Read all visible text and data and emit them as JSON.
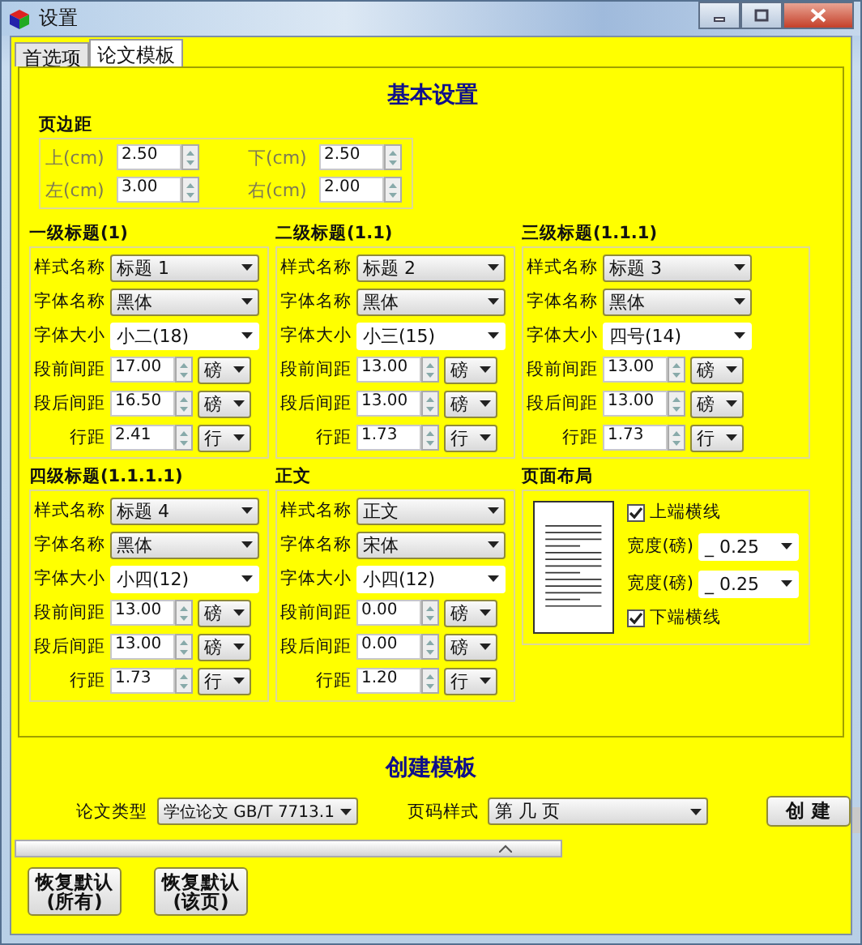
{
  "window": {
    "title": "设置"
  },
  "tabs": [
    {
      "label": "首选项",
      "selected": false
    },
    {
      "label": "论文模板",
      "selected": true
    }
  ],
  "basic_settings": {
    "title": "基本设置",
    "margins": {
      "title": "页边距",
      "fields": [
        {
          "label": "上(cm)",
          "value": "2.50"
        },
        {
          "label": "下(cm)",
          "value": "2.50"
        },
        {
          "label": "左(cm)",
          "value": "3.00"
        },
        {
          "label": "右(cm)",
          "value": "2.00"
        }
      ]
    },
    "groups": [
      {
        "title": "一级标题(1)",
        "rows": [
          {
            "kind": "select",
            "label": "样式名称",
            "value": "标题 1"
          },
          {
            "kind": "select",
            "label": "字体名称",
            "value": "黑体"
          },
          {
            "kind": "plain_select",
            "label": "字体大小",
            "value": "小二(18)"
          },
          {
            "kind": "spin",
            "label": "段前间距",
            "value": "17.00",
            "unit": "磅"
          },
          {
            "kind": "spin",
            "label": "段后间距",
            "value": "16.50",
            "unit": "磅"
          },
          {
            "kind": "spin",
            "label": "行距",
            "value": "2.41",
            "unit": "行"
          }
        ]
      },
      {
        "title": "二级标题(1.1)",
        "rows": [
          {
            "kind": "select",
            "label": "样式名称",
            "value": "标题 2"
          },
          {
            "kind": "select",
            "label": "字体名称",
            "value": "黑体"
          },
          {
            "kind": "plain_select",
            "label": "字体大小",
            "value": "小三(15)"
          },
          {
            "kind": "spin",
            "label": "段前间距",
            "value": "13.00",
            "unit": "磅"
          },
          {
            "kind": "spin",
            "label": "段后间距",
            "value": "13.00",
            "unit": "磅"
          },
          {
            "kind": "spin",
            "label": "行距",
            "value": "1.73",
            "unit": "行"
          }
        ]
      },
      {
        "title": "三级标题(1.1.1)",
        "rows": [
          {
            "kind": "select",
            "label": "样式名称",
            "value": "标题 3"
          },
          {
            "kind": "select",
            "label": "字体名称",
            "value": "黑体"
          },
          {
            "kind": "plain_select",
            "label": "字体大小",
            "value": "四号(14)"
          },
          {
            "kind": "spin",
            "label": "段前间距",
            "value": "13.00",
            "unit": "磅"
          },
          {
            "kind": "spin",
            "label": "段后间距",
            "value": "13.00",
            "unit": "磅"
          },
          {
            "kind": "spin",
            "label": "行距",
            "value": "1.73",
            "unit": "行"
          }
        ]
      },
      {
        "title": "四级标题(1.1.1.1)",
        "rows": [
          {
            "kind": "select",
            "label": "样式名称",
            "value": "标题 4"
          },
          {
            "kind": "select",
            "label": "字体名称",
            "value": "黑体"
          },
          {
            "kind": "plain_select",
            "label": "字体大小",
            "value": "小四(12)"
          },
          {
            "kind": "spin",
            "label": "段前间距",
            "value": "13.00",
            "unit": "磅"
          },
          {
            "kind": "spin",
            "label": "段后间距",
            "value": "13.00",
            "unit": "磅"
          },
          {
            "kind": "spin",
            "label": "行距",
            "value": "1.73",
            "unit": "行"
          }
        ]
      },
      {
        "title": "正文",
        "rows": [
          {
            "kind": "select",
            "label": "样式名称",
            "value": "正文"
          },
          {
            "kind": "select",
            "label": "字体名称",
            "value": "宋体"
          },
          {
            "kind": "plain_select",
            "label": "字体大小",
            "value": "小四(12)"
          },
          {
            "kind": "spin",
            "label": "段前间距",
            "value": "0.00",
            "unit": "磅"
          },
          {
            "kind": "spin",
            "label": "段后间距",
            "value": "0.00",
            "unit": "磅"
          },
          {
            "kind": "spin",
            "label": "行距",
            "value": "1.20",
            "unit": "行"
          }
        ]
      }
    ],
    "page_layout": {
      "title": "页面布局",
      "options": [
        {
          "kind": "checkbox",
          "label": "上端横线",
          "checked": true
        },
        {
          "kind": "select",
          "label": "宽度(磅)",
          "value": "_ 0.25"
        },
        {
          "kind": "select",
          "label": "宽度(磅)",
          "value": "_ 0.25"
        },
        {
          "kind": "checkbox",
          "label": "下端横线",
          "checked": true
        }
      ]
    }
  },
  "create_template": {
    "title": "创建模板",
    "fields": [
      {
        "label": "论文类型",
        "value": "学位论文 GB/T 7713.1"
      },
      {
        "label": "页码样式",
        "value": "第 几 页"
      }
    ],
    "button": "创 建"
  },
  "buttons": [
    {
      "label": "恢复默认\n(所有)"
    },
    {
      "label": "恢复默认\n(该页)"
    }
  ]
}
